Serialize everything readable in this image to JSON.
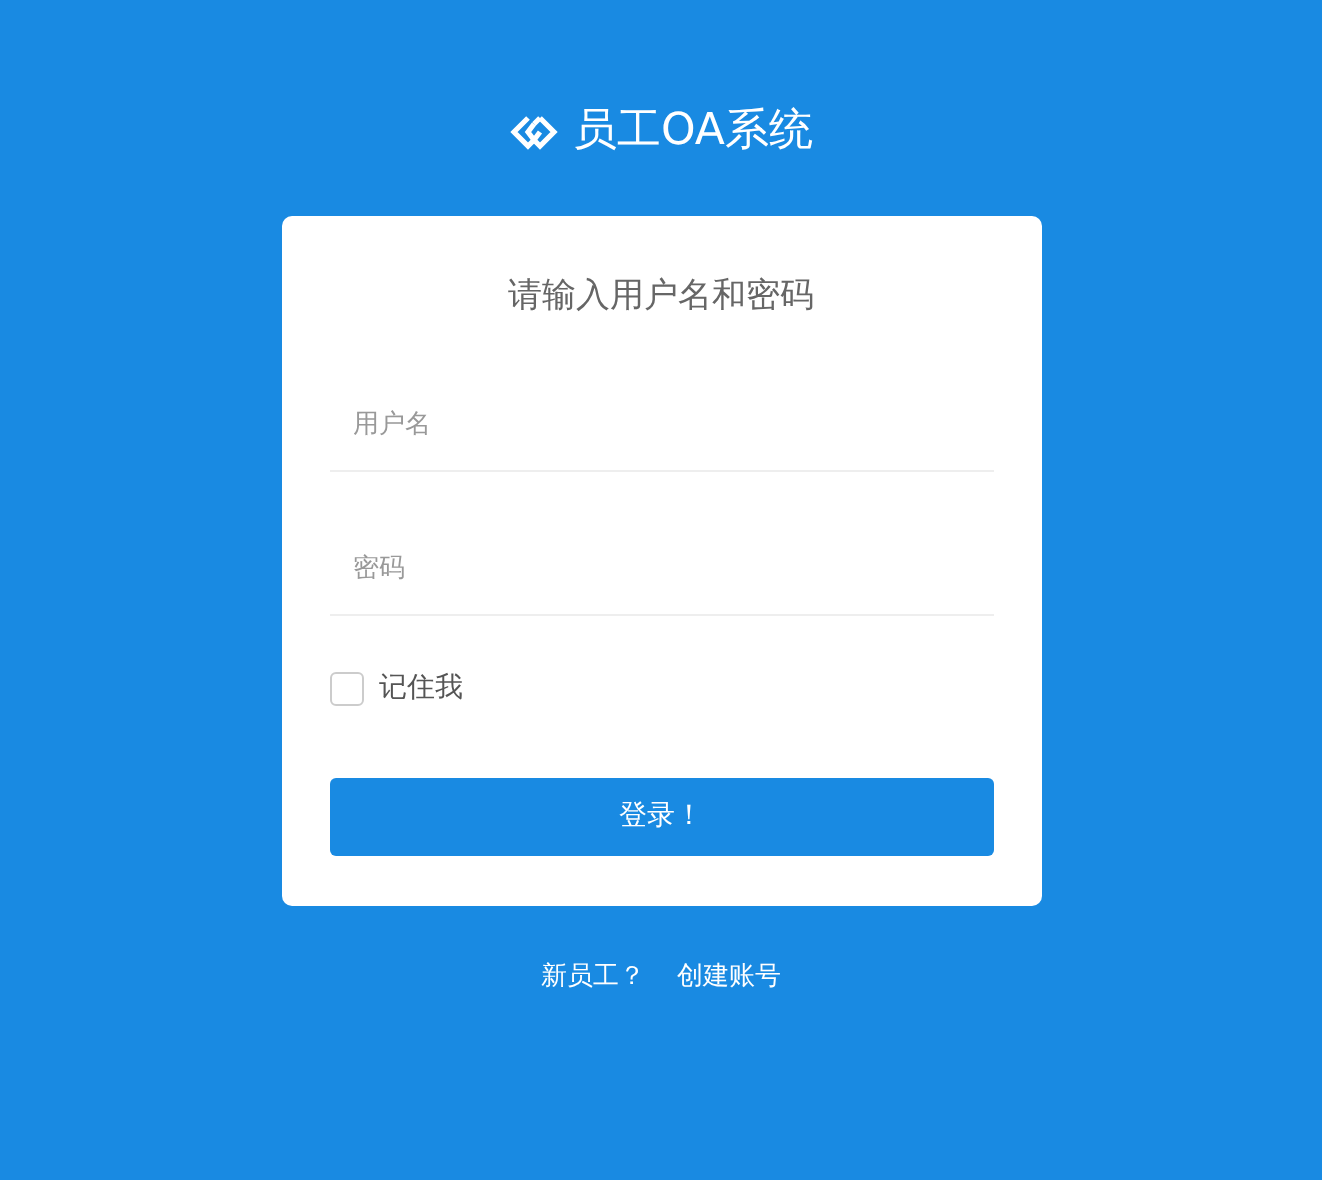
{
  "brand": {
    "title": "员工OA系统"
  },
  "form": {
    "heading": "请输入用户名和密码",
    "fields": [
      {
        "placeholder": "用户名"
      },
      {
        "placeholder": "密码"
      }
    ],
    "remember": {
      "label": "记住我",
      "checked": false
    },
    "submit": "登录！"
  },
  "footer": {
    "prompt": "新员工？",
    "link": "创建账号"
  }
}
